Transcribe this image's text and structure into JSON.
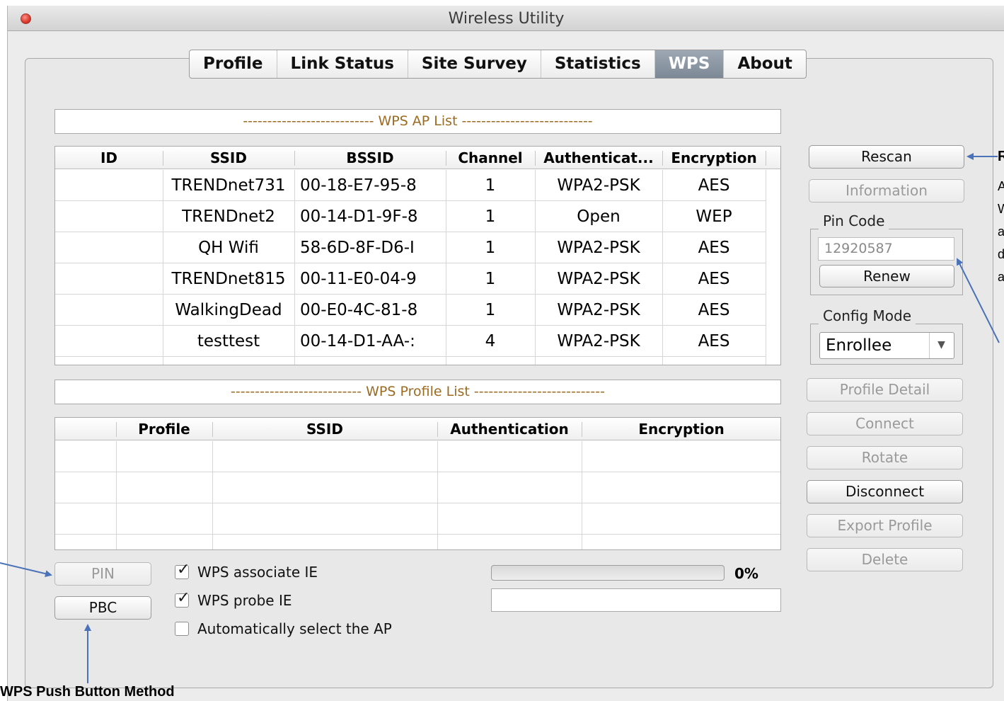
{
  "window": {
    "title": "Wireless Utility"
  },
  "tabs": [
    {
      "label": "Profile",
      "active": false
    },
    {
      "label": "Link Status",
      "active": false
    },
    {
      "label": "Site Survey",
      "active": false
    },
    {
      "label": "Statistics",
      "active": false
    },
    {
      "label": "WPS",
      "active": true
    },
    {
      "label": "About",
      "active": false
    }
  ],
  "ap_list": {
    "title": "--------------------------- WPS AP List ---------------------------",
    "columns": [
      "ID",
      "SSID",
      "BSSID",
      "Channel",
      "Authenticat...",
      "Encryption"
    ],
    "rows": [
      {
        "id": "",
        "ssid": "TRENDnet731",
        "bssid": "00-18-E7-95-8",
        "channel": "1",
        "auth": "WPA2-PSK",
        "enc": "AES"
      },
      {
        "id": "",
        "ssid": "TRENDnet2",
        "bssid": "00-14-D1-9F-8",
        "channel": "1",
        "auth": "Open",
        "enc": "WEP"
      },
      {
        "id": "",
        "ssid": "QH Wifi",
        "bssid": "58-6D-8F-D6-I",
        "channel": "1",
        "auth": "WPA2-PSK",
        "enc": "AES"
      },
      {
        "id": "",
        "ssid": "TRENDnet815",
        "bssid": "00-11-E0-04-9",
        "channel": "1",
        "auth": "WPA2-PSK",
        "enc": "AES"
      },
      {
        "id": "",
        "ssid": "WalkingDead",
        "bssid": "00-E0-4C-81-8",
        "channel": "1",
        "auth": "WPA2-PSK",
        "enc": "AES"
      },
      {
        "id": "",
        "ssid": "testtest",
        "bssid": "00-14-D1-AA-:",
        "channel": "4",
        "auth": "WPA2-PSK",
        "enc": "AES"
      }
    ]
  },
  "profile_list": {
    "title": "--------------------------- WPS Profile List ---------------------------",
    "columns": [
      "",
      "Profile",
      "SSID",
      "Authentication",
      "Encryption"
    ]
  },
  "side_buttons": {
    "rescan": "Rescan",
    "information": "Information",
    "pin_code_label": "Pin Code",
    "pin_code_value": "12920587",
    "renew": "Renew",
    "config_mode_label": "Config Mode",
    "config_mode_value": "Enrollee",
    "profile_detail": "Profile Detail",
    "connect": "Connect",
    "rotate": "Rotate",
    "disconnect": "Disconnect",
    "export_profile": "Export Profile",
    "delete": "Delete"
  },
  "bottom": {
    "pin": "PIN",
    "pbc": "PBC",
    "wps_associate_ie": {
      "label": "WPS associate IE",
      "checked": true
    },
    "wps_probe_ie": {
      "label": "WPS probe IE",
      "checked": true
    },
    "auto_select_ap": {
      "label": "Automatically select the AP",
      "checked": false
    },
    "progress_percent": 0,
    "progress_text": "0%"
  },
  "annotations": {
    "push_button_method": "WPS Push Button Method",
    "right_r": "R",
    "right_lines": [
      "A",
      "W",
      "a",
      "d",
      "a"
    ]
  }
}
